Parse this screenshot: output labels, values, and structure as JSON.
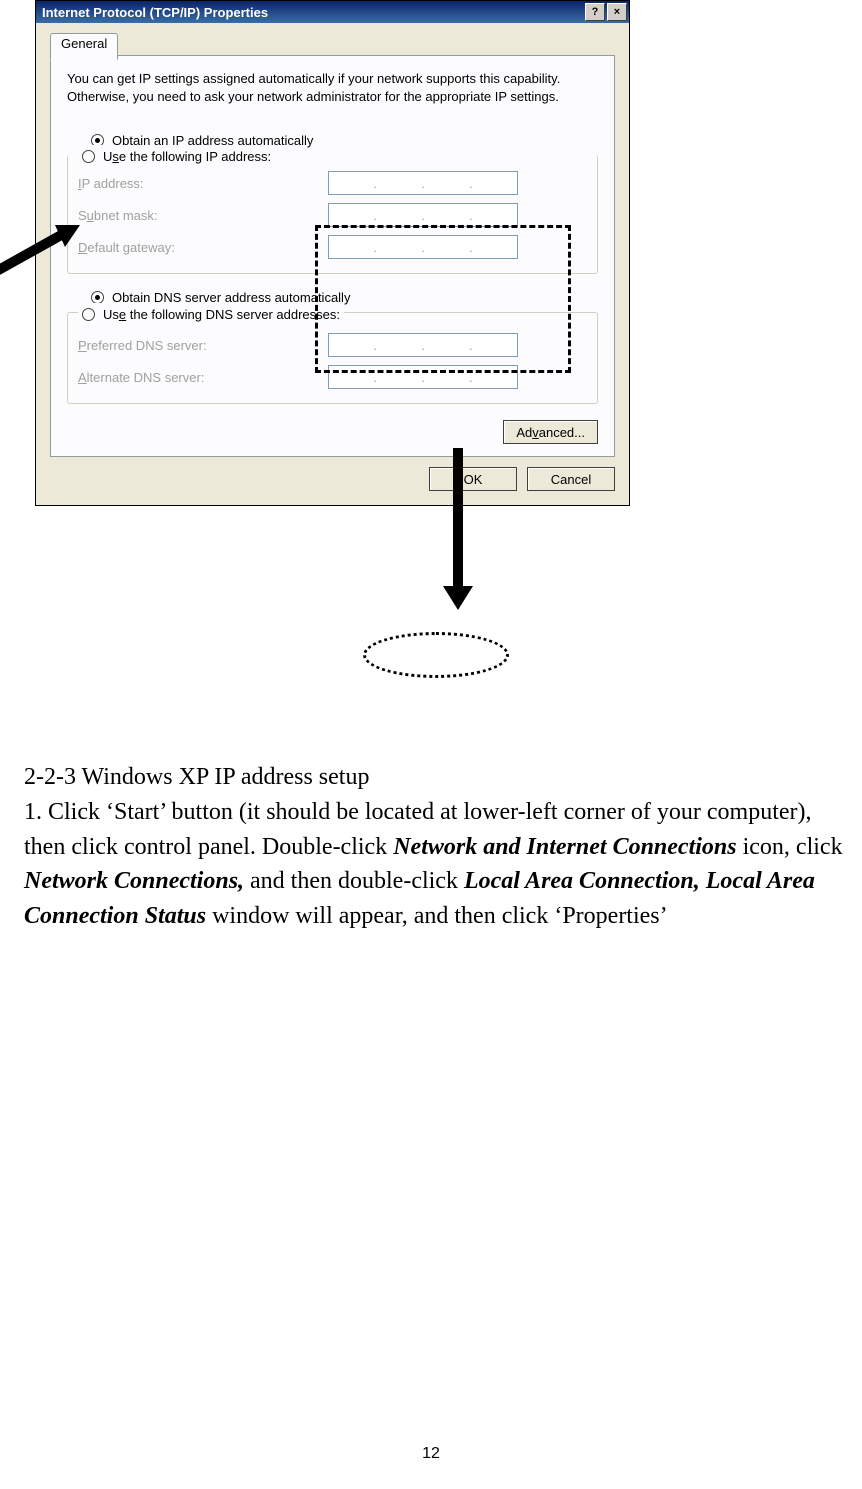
{
  "dialog": {
    "title": "Internet Protocol (TCP/IP) Properties",
    "tab": "General",
    "intro": "You can get IP settings assigned automatically if your network supports this capability. Otherwise, you need to ask your network administrator for the appropriate IP settings.",
    "radio_obtain_ip": "Obtain an IP address automatically",
    "radio_use_ip": "Use the following IP address:",
    "label_ip": "IP address:",
    "label_subnet": "Subnet mask:",
    "label_gateway": "Default gateway:",
    "radio_obtain_dns": "Obtain DNS server address automatically",
    "radio_use_dns": "Use the following DNS server addresses:",
    "label_pref_dns": "Preferred DNS server:",
    "label_alt_dns": "Alternate DNS server:",
    "btn_advanced": "Advanced...",
    "btn_ok": "OK",
    "btn_cancel": "Cancel",
    "help": "?",
    "close": "×"
  },
  "doc": {
    "heading": "2-2-3 Windows XP IP address setup",
    "step1_a": "1. Click ‘Start’ button (it should be located at lower-left corner of your computer), then click control panel. Double-click ",
    "step1_b": "Network and Internet Connections",
    "step1_c": " icon, click ",
    "step1_d": "Network Connections,",
    "step1_e": " and then double-click ",
    "step1_f": "Local Area Connection, Local Area Connection Status",
    "step1_g": " window will appear, and then click ‘Properties’",
    "pagenum": "12"
  }
}
